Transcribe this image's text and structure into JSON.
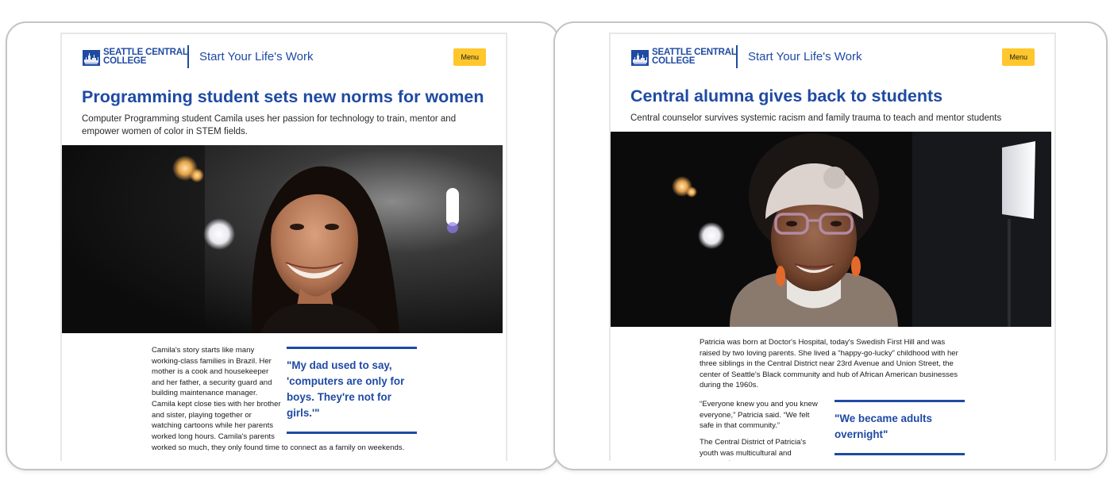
{
  "colors": {
    "brand_blue": "#1f4aa3",
    "menu_yellow": "#ffc72c"
  },
  "articles": [
    {
      "logo": {
        "line1": "SEATTLE CENTRAL",
        "line2": "COLLEGE"
      },
      "tagline": "Start Your Life's Work",
      "menu_label": "Menu",
      "headline": "Programming student sets new norms for women",
      "subhead": "Computer Programming student Camila uses her passion for technology to train, mentor and empower women of color in STEM fields.",
      "hero_alt": "Portrait of a smiling woman with long dark hair against a dark background with bokeh lights",
      "paragraphs": [
        "Camila's story starts like many working-class families in Brazil. Her mother is a cook and housekeeper and her father, a security guard and building maintenance manager. Camila kept close ties with her brother and sister, playing together or watching cartoons while her parents worked long hours. Camila's parents",
        "worked so much, they only found time to connect as a family on weekends."
      ],
      "pullquote": "\"My dad used to say, 'computers are only for boys. They're not for girls.'\""
    },
    {
      "logo": {
        "line1": "SEATTLE CENTRAL",
        "line2": "COLLEGE"
      },
      "tagline": "Start Your Life's Work",
      "menu_label": "Menu",
      "headline": "Central alumna gives back to students",
      "subhead": "Central counselor survives systemic racism and family trauma to teach and mentor students",
      "hero_alt": "Portrait of a smiling woman wearing glasses and a knit headband against a dark background",
      "paragraphs": [
        "Patricia was born at Doctor's Hospital, today's Swedish First Hill and was raised by two loving parents. She lived a “happy-go-lucky” childhood with her three siblings in the Central District near 23rd Avenue and Union Street, the center of Seattle's Black community and hub of African American businesses during the 1960s.",
        "“Everyone knew you and you knew everyone,” Patricia said. “We felt safe in that community.”",
        "The Central District of Patricia's youth was multicultural and community"
      ],
      "pullquote": "\"We became adults overnight\""
    }
  ]
}
